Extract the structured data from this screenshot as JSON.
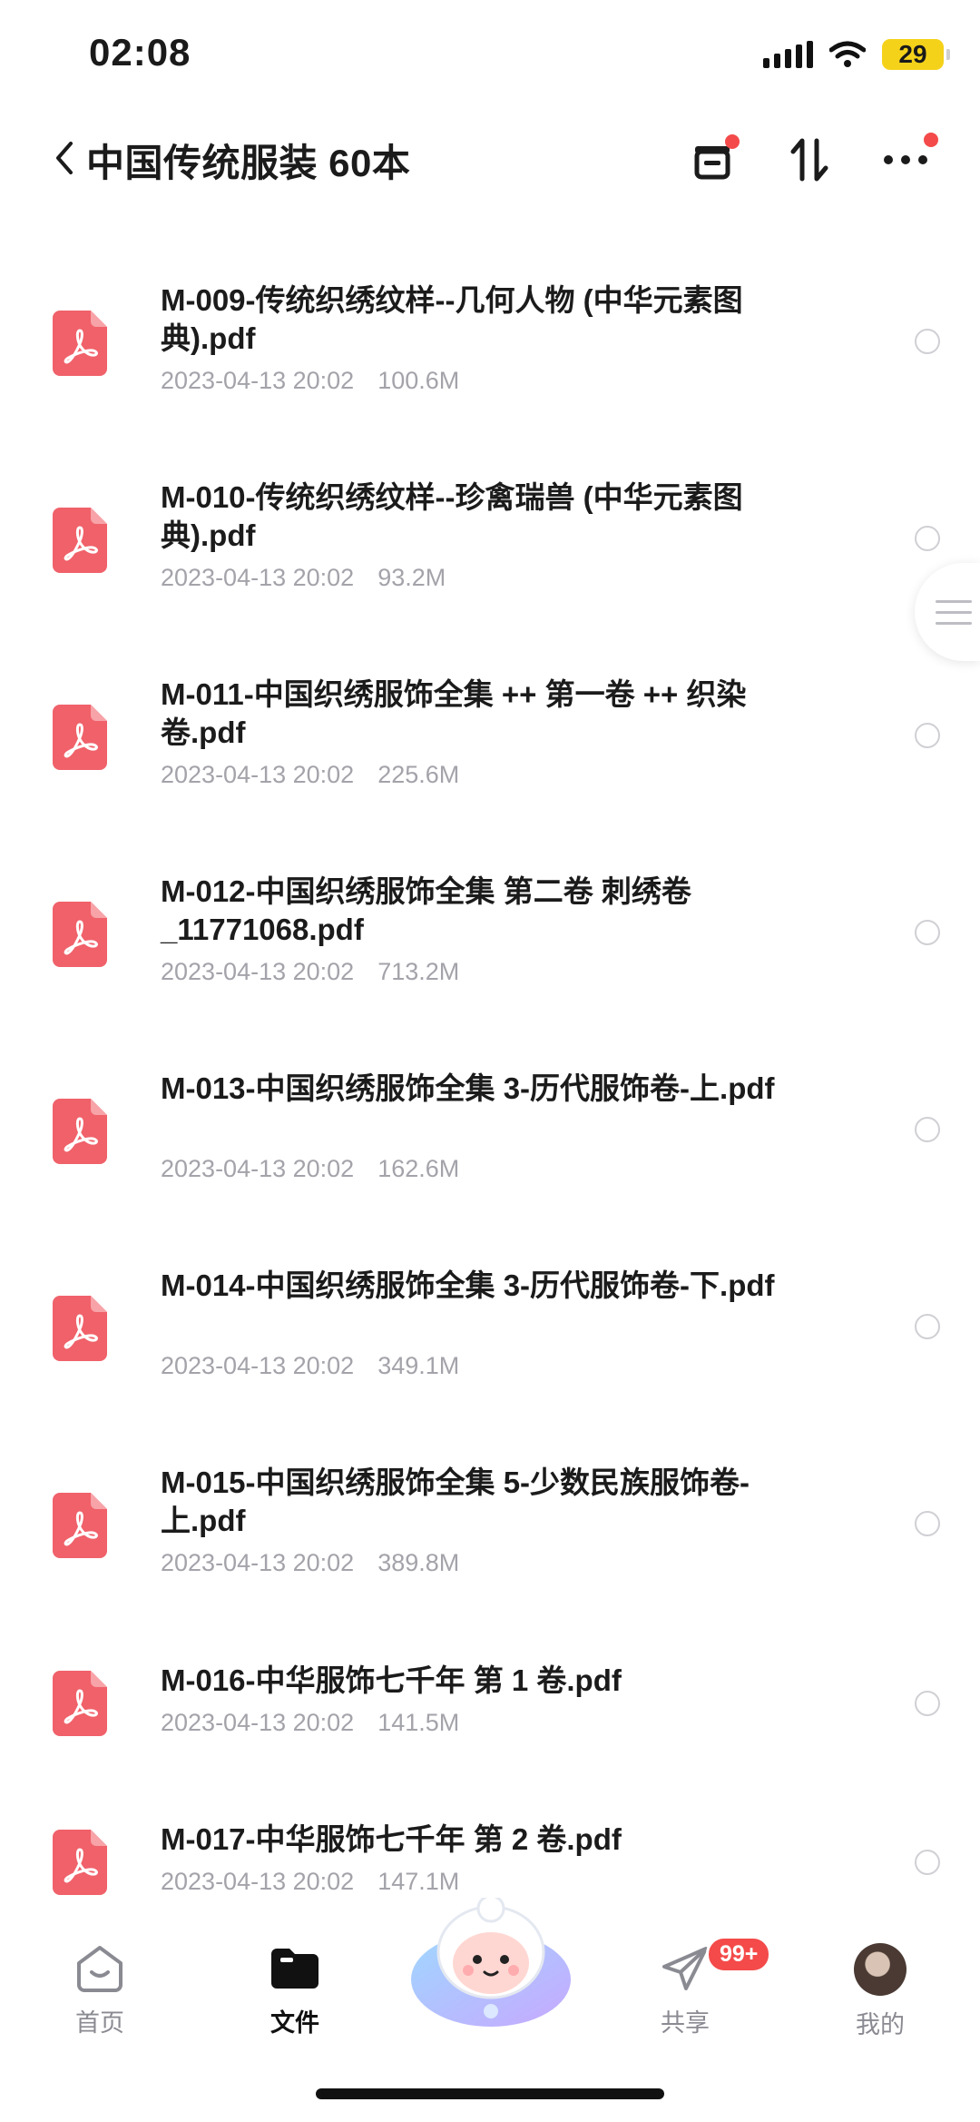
{
  "status_bar": {
    "time": "02:08",
    "battery": "29"
  },
  "header": {
    "title": "中国传统服装 60本"
  },
  "files": [
    {
      "name": "M-009-传统织绣纹样--几何人物 (中华元素图典).pdf",
      "date": "2023-04-13 20:02",
      "size": "100.6M"
    },
    {
      "name": "M-010-传统织绣纹样--珍禽瑞兽 (中华元素图典).pdf",
      "date": "2023-04-13 20:02",
      "size": "93.2M"
    },
    {
      "name": "M-011-中国织绣服饰全集 ++ 第一卷 ++ 织染卷.pdf",
      "date": "2023-04-13 20:02",
      "size": "225.6M"
    },
    {
      "name": "M-012-中国织绣服饰全集  第二卷  刺绣卷_11771068.pdf",
      "date": "2023-04-13 20:02",
      "size": "713.2M"
    },
    {
      "name": "M-013-中国织绣服饰全集 3-历代服饰卷-上.pdf",
      "date": "2023-04-13 20:02",
      "size": "162.6M"
    },
    {
      "name": "M-014-中国织绣服饰全集 3-历代服饰卷-下.pdf",
      "date": "2023-04-13 20:02",
      "size": "349.1M"
    },
    {
      "name": "M-015-中国织绣服饰全集 5-少数民族服饰卷-上.pdf",
      "date": "2023-04-13 20:02",
      "size": "389.8M"
    },
    {
      "name": "M-016-中华服饰七千年  第 1 卷.pdf",
      "date": "2023-04-13 20:02",
      "size": "141.5M"
    },
    {
      "name": "M-017-中华服饰七千年  第 2 卷.pdf",
      "date": "2023-04-13 20:02",
      "size": "147.1M"
    }
  ],
  "tabs": [
    {
      "label": "首页",
      "icon": "home-icon"
    },
    {
      "label": "文件",
      "icon": "folder-icon"
    },
    {
      "label": "共享",
      "icon": "send-icon"
    },
    {
      "label": "我的",
      "icon": "avatar"
    }
  ],
  "share_badge": "99+",
  "colors": {
    "pdf": "#f0616a",
    "badge": "#f44a4a",
    "battery": "#f5d21a"
  }
}
